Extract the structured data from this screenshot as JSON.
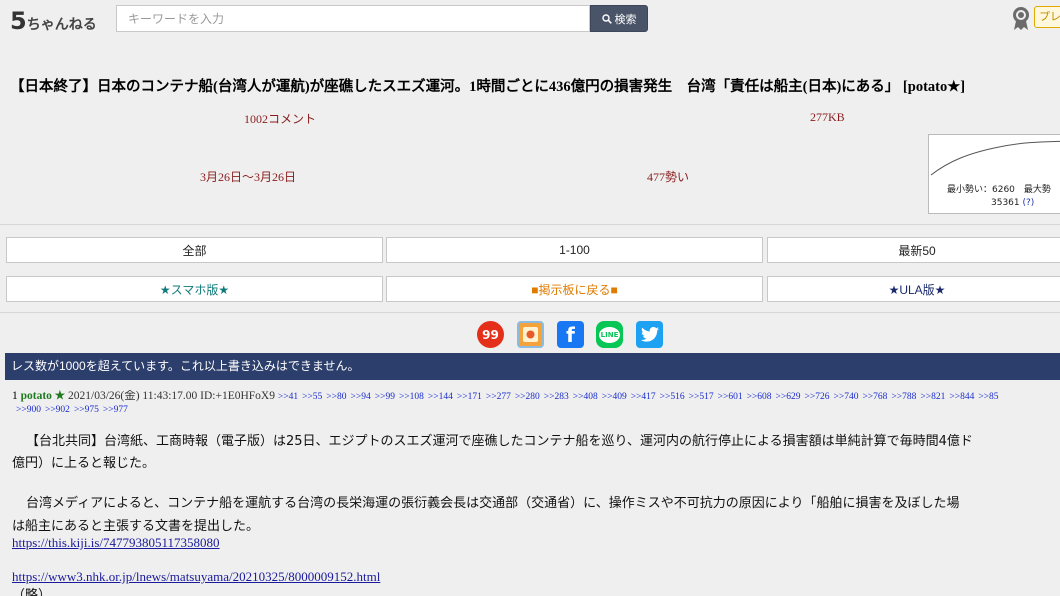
{
  "header": {
    "logo_five": "5",
    "logo_text": "ちゃんねる",
    "search_placeholder": "キーワードを入力",
    "search_button": "検索",
    "premium_label": "プレ"
  },
  "thread": {
    "title": "【日本終了】日本のコンテナ船(台湾人が運航)が座礁したスエズ運河。1時間ごとに436億円の損害発生　台湾「責任は船主(日本)にある」 [potato★]",
    "comments": "1002コメント",
    "size": "277KB",
    "dates": "3月26日～3月26日",
    "momentum": "477勢い",
    "graph_line1": "最小勢い：6260　最大勢",
    "graph_line2": "35361",
    "graph_help": "(?)"
  },
  "nav": {
    "all": "全部",
    "range": "1-100",
    "latest": "最新50",
    "smartphone": "★スマホ版★",
    "back_to_board": "■掲示板に戻る■",
    "ula": "★ULA版★"
  },
  "share": {
    "s99": "99",
    "fb": "f",
    "line": "LINE"
  },
  "notice": "レス数が1000を超えています。これ以上書き込みはできません。",
  "post": {
    "number": "1",
    "name": "potato ★",
    "datetime": "2021/03/26(金) 11:43:17.00 ID:+1E0HFoX9",
    "anchors_row1": [
      ">>41",
      ">>55",
      ">>80",
      ">>94",
      ">>99",
      ">>108",
      ">>144",
      ">>171",
      ">>277",
      ">>280",
      ">>283",
      ">>408",
      ">>409",
      ">>417",
      ">>516",
      ">>517",
      ">>601",
      ">>608",
      ">>629",
      ">>726",
      ">>740",
      ">>768",
      ">>788",
      ">>821",
      ">>844",
      ">>85"
    ],
    "anchors_row2": [
      ">>900",
      ">>902",
      ">>975",
      ">>977"
    ],
    "line1": "【台北共同】台湾紙、工商時報（電子版）は25日、エジプトのスエズ運河で座礁したコンテナ船を巡り、運河内の航行停止による損害額は単純計算で毎時間4億ド",
    "line2": "億円）に上ると報じた。",
    "line3": "台湾メディアによると、コンテナ船を運航する台湾の長栄海運の張衍義会長は交通部（交通省）に、操作ミスや不可抗力の原因により「船舶に損害を及ぼした場",
    "line4": "は船主にあると主張する文書を提出した。",
    "link1": "https://this.kiji.is/747793805117358080",
    "link2": "https://www3.nhk.or.jp/lnews/matsuyama/20210325/8000009152.html",
    "line5": "（略）"
  },
  "colors": {
    "notice_bg": "#2c3e6b",
    "meta_text": "#8a1d1d",
    "name_green": "#1e7a1e",
    "anchor_blue": "#1a2ccc",
    "search_button_bg": "#4a5468"
  }
}
